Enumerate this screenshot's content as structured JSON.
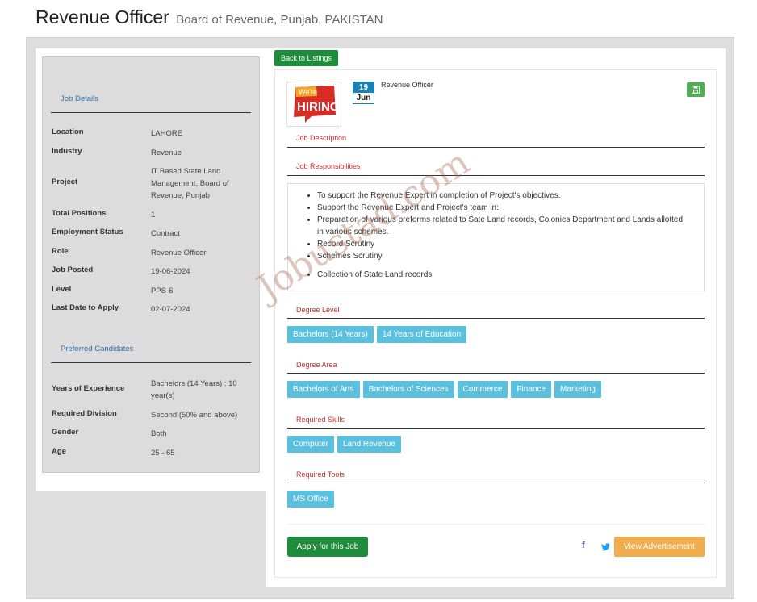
{
  "header": {
    "title": "Revenue Officer",
    "subtitle": "Board of Revenue, Punjab, PAKISTAN"
  },
  "sidebar": {
    "job_details_heading": "Job Details",
    "details": [
      {
        "label": "Location",
        "value": "LAHORE"
      },
      {
        "label": "Industry",
        "value": "Revenue"
      },
      {
        "label": "Project",
        "value": "IT Based State Land Management, Board of Revenue, Punjab"
      },
      {
        "label": "Total Positions",
        "value": "1"
      },
      {
        "label": "Employment Status",
        "value": "Contract"
      },
      {
        "label": "Role",
        "value": "Revenue Officer"
      },
      {
        "label": "Job Posted",
        "value": "19-06-2024"
      },
      {
        "label": "Level",
        "value": "PPS-6"
      },
      {
        "label": "Last Date to Apply",
        "value": "02-07-2024"
      }
    ],
    "preferred_heading": "Preferred Candidates",
    "preferred": [
      {
        "label": "Years of Experience",
        "value": "Bachelors (14 Years) : 10 year(s)"
      },
      {
        "label": "Required Division",
        "value": "Second (50% and above)"
      },
      {
        "label": "Gender",
        "value": "Both"
      },
      {
        "label": "Age",
        "value": "25 - 65"
      }
    ]
  },
  "main": {
    "back_label": "Back to Listings",
    "logo_text_top": "We're",
    "logo_text_main": "HIRING",
    "date_day": "19",
    "date_month": "Jun",
    "job_name": "Revenue Officer",
    "job_description_heading": "Job Description",
    "job_responsibilities_heading": "Job Responsibilities",
    "responsibilities": [
      "To support the Revenue Expert in completion of Project's objectives.",
      "Support the Revenue Expert and Project's team in:",
      "Preparation of various preforms related to Sate Land records, Colonies Department and Lands allotted in various schemes.",
      "Record Scrutiny",
      "Schemes Scrutiny",
      "Collection of State Land records"
    ],
    "degree_level_heading": "Degree Level",
    "degree_level_tags": [
      "Bachelors (14 Years)",
      "14 Years of Education"
    ],
    "degree_area_heading": "Degree Area",
    "degree_area_tags": [
      "Bachelors of Arts",
      "Bachelors of Sciences",
      "Commerce",
      "Finance",
      "Marketing"
    ],
    "required_skills_heading": "Required Skills",
    "required_skills_tags": [
      "Computer",
      "Land Revenue"
    ],
    "required_tools_heading": "Required Tools",
    "required_tools_tags": [
      "MS Office"
    ],
    "apply_label": "Apply for this Job",
    "facebook_glyph": "f",
    "view_ad_label": "View Advertisement"
  },
  "watermark": "Jobustad.com"
}
